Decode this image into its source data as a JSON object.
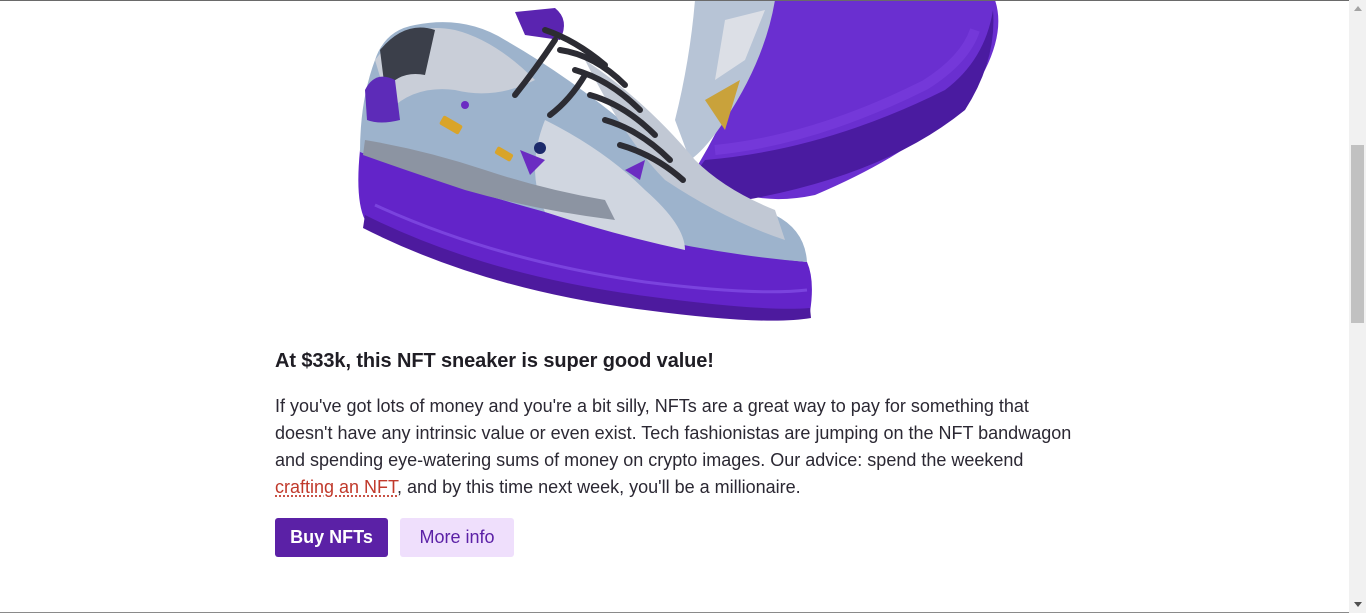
{
  "article": {
    "image_alt": "NFT sneaker",
    "headline": "At $33k, this NFT sneaker is super good value!",
    "body_before_link": "If you've got lots of money and you're a bit silly, NFTs are a great way to pay for something that doesn't have any intrinsic value or even exist. Tech fashionistas are jumping on the NFT bandwagon and spending eye-watering sums of money on crypto images. Our advice: spend the weekend ",
    "link_text": "crafting an NFT",
    "body_after_link": ", and by this time next week, you'll be a millionaire."
  },
  "buttons": {
    "primary_label": "Buy NFTs",
    "secondary_label": "More info"
  },
  "colors": {
    "brand_purple": "#5b21a6",
    "secondary_bg": "#efdffc",
    "link_red": "#c0392b"
  },
  "scrollbar": {
    "scroll_position": 0.22
  }
}
